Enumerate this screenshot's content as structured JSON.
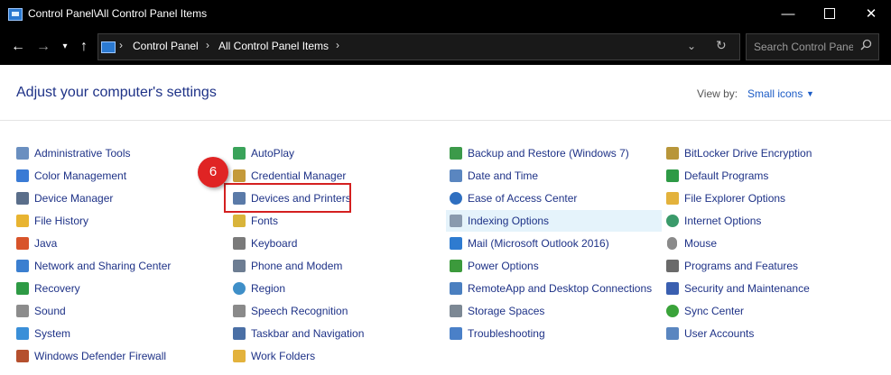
{
  "window": {
    "title": "Control Panel\\All Control Panel Items",
    "minimize_glyph": "—",
    "close_glyph": "✕"
  },
  "nav": {
    "back": "←",
    "forward": "→",
    "recent": "▾",
    "up": "↑",
    "breadcrumbs": [
      "Control Panel",
      "All Control Panel Items"
    ],
    "separator": "›",
    "dropdown": "⌄",
    "refresh": "↻",
    "search_placeholder": "Search Control Panel"
  },
  "header": {
    "title": "Adjust your computer's settings",
    "view_by_label": "View by:",
    "view_by_value": "Small icons",
    "view_by_caret": "▼"
  },
  "columns": [
    [
      {
        "label": "Administrative Tools",
        "icon": "admin-tools-icon",
        "color": "#6a8fc0"
      },
      {
        "label": "Color Management",
        "icon": "color-management-icon",
        "color": "#3a7bd5"
      },
      {
        "label": "Device Manager",
        "icon": "device-manager-icon",
        "color": "#5a6e8a"
      },
      {
        "label": "File History",
        "icon": "file-history-icon",
        "color": "#e8b431"
      },
      {
        "label": "Java",
        "icon": "java-icon",
        "color": "#d8542a"
      },
      {
        "label": "Network and Sharing Center",
        "icon": "network-icon",
        "color": "#3b7fd0"
      },
      {
        "label": "Recovery",
        "icon": "recovery-icon",
        "color": "#2e9a45"
      },
      {
        "label": "Sound",
        "icon": "sound-icon",
        "color": "#8c8c8c"
      },
      {
        "label": "System",
        "icon": "system-icon",
        "color": "#3a8fd8"
      },
      {
        "label": "Windows Defender Firewall",
        "icon": "firewall-icon",
        "color": "#b5502e"
      }
    ],
    [
      {
        "label": "AutoPlay",
        "icon": "autoplay-icon",
        "color": "#3aa35a"
      },
      {
        "label": "Credential Manager",
        "icon": "credential-manager-icon",
        "color": "#c49a3a"
      },
      {
        "label": "Devices and Printers",
        "icon": "devices-printers-icon",
        "color": "#5a7aa8"
      },
      {
        "label": "Fonts",
        "icon": "fonts-icon",
        "color": "#d9b43a"
      },
      {
        "label": "Keyboard",
        "icon": "keyboard-icon",
        "color": "#7a7a7a"
      },
      {
        "label": "Phone and Modem",
        "icon": "phone-modem-icon",
        "color": "#6d7d92"
      },
      {
        "label": "Region",
        "icon": "region-icon",
        "color": "#3f8fc8"
      },
      {
        "label": "Speech Recognition",
        "icon": "microphone-icon",
        "color": "#8a8a8a"
      },
      {
        "label": "Taskbar and Navigation",
        "icon": "taskbar-icon",
        "color": "#4a6fa5"
      },
      {
        "label": "Work Folders",
        "icon": "work-folders-icon",
        "color": "#e3b23c"
      }
    ],
    [
      {
        "label": "Backup and Restore (Windows 7)",
        "icon": "backup-restore-icon",
        "color": "#3c9a4a"
      },
      {
        "label": "Date and Time",
        "icon": "date-time-icon",
        "color": "#5a86c0"
      },
      {
        "label": "Ease of Access Center",
        "icon": "ease-of-access-icon",
        "color": "#2f6fc0"
      },
      {
        "label": "Indexing Options",
        "icon": "indexing-icon",
        "color": "#8a9aae"
      },
      {
        "label": "Mail (Microsoft Outlook 2016)",
        "icon": "mail-icon",
        "color": "#2e7bd0"
      },
      {
        "label": "Power Options",
        "icon": "power-icon",
        "color": "#3c9a3c"
      },
      {
        "label": "RemoteApp and Desktop Connections",
        "icon": "remoteapp-icon",
        "color": "#4a7fc0"
      },
      {
        "label": "Storage Spaces",
        "icon": "storage-spaces-icon",
        "color": "#7c8894"
      },
      {
        "label": "Troubleshooting",
        "icon": "troubleshooting-icon",
        "color": "#4a80c8"
      }
    ],
    [
      {
        "label": "BitLocker Drive Encryption",
        "icon": "bitlocker-icon",
        "color": "#b8963a"
      },
      {
        "label": "Default Programs",
        "icon": "default-programs-icon",
        "color": "#2e9a45"
      },
      {
        "label": "File Explorer Options",
        "icon": "file-explorer-options-icon",
        "color": "#e3b23c"
      },
      {
        "label": "Internet Options",
        "icon": "internet-options-icon",
        "color": "#3a9a6a"
      },
      {
        "label": "Mouse",
        "icon": "mouse-icon",
        "color": "#8a8a8a"
      },
      {
        "label": "Programs and Features",
        "icon": "programs-features-icon",
        "color": "#6a6a6a"
      },
      {
        "label": "Security and Maintenance",
        "icon": "flag-icon",
        "color": "#3a5fb0"
      },
      {
        "label": "Sync Center",
        "icon": "sync-center-icon",
        "color": "#3aa33a"
      },
      {
        "label": "User Accounts",
        "icon": "user-accounts-icon",
        "color": "#5a86c0"
      }
    ]
  ],
  "annotation": {
    "step_number": "6",
    "color": "#e02424"
  },
  "accent_link": "#1e3287"
}
